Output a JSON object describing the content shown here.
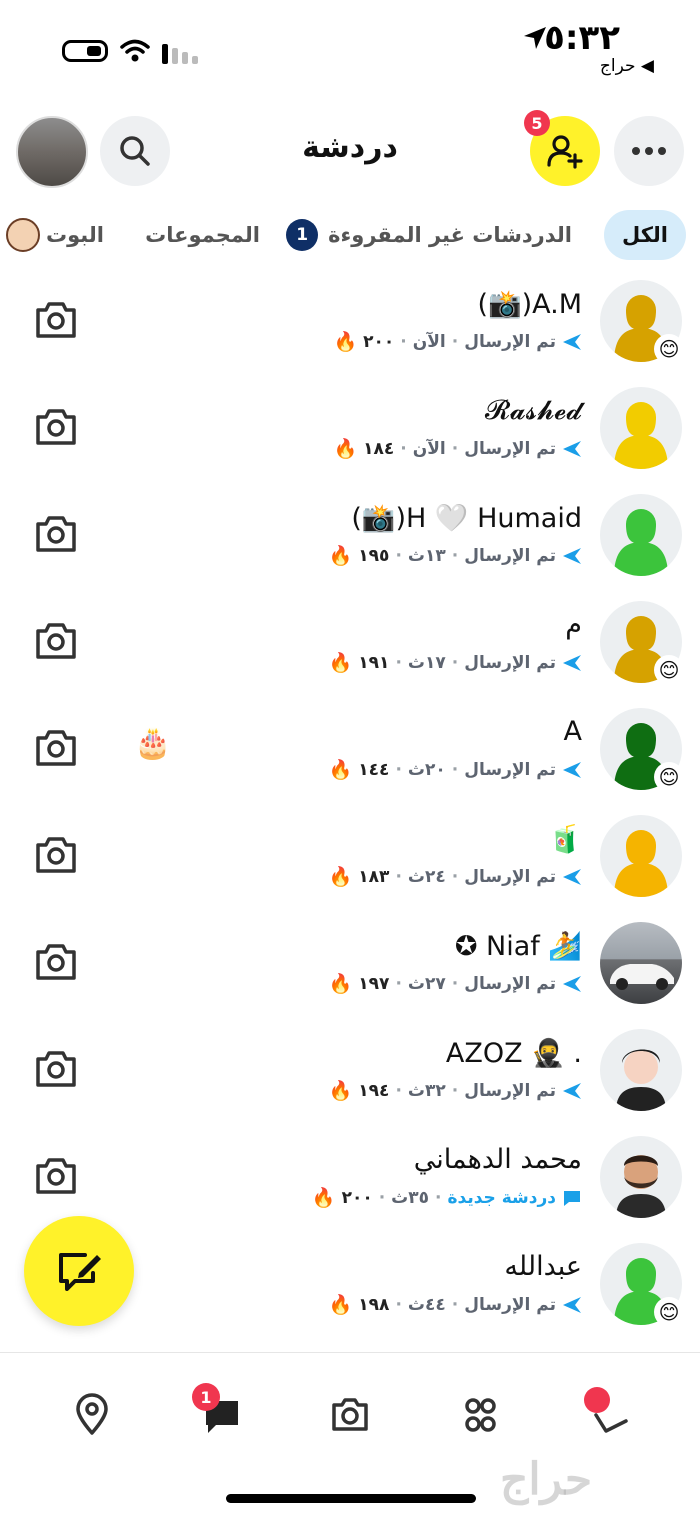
{
  "status_bar": {
    "time": "٥:٣٢",
    "back_app": "◀ حراج"
  },
  "header": {
    "title": "دردشة",
    "friend_requests_badge": "5"
  },
  "tabs": {
    "all": "الكل",
    "unread": "الدردشات غير المقروءة",
    "unread_count": "1",
    "groups": "المجموعات",
    "bots": "البوت"
  },
  "chats": [
    {
      "name": "A.M(📸)",
      "status": "تم الإرسال",
      "time": "الآن",
      "streak": "٢٠٠",
      "fire": "🔥",
      "avatar_color": "#d6a200",
      "emoji_badge": "😊"
    },
    {
      "name": "𝓡𝓪𝓼𝓱𝓮𝓭",
      "status": "تم الإرسال",
      "time": "الآن",
      "streak": "١٨٤",
      "fire": "🔥",
      "avatar_color": "#f2cc00",
      "emoji_badge": ""
    },
    {
      "name": "H 🤍 Humaid(📸)",
      "status": "تم الإرسال",
      "time": "١٣ث",
      "streak": "١٩٥",
      "fire": "🔥",
      "avatar_color": "#3cc43c",
      "emoji_badge": ""
    },
    {
      "name": "م",
      "status": "تم الإرسال",
      "time": "١٧ث",
      "streak": "١٩١",
      "fire": "🔥",
      "avatar_color": "#d6a200",
      "emoji_badge": "😊"
    },
    {
      "name": "A",
      "status": "تم الإرسال",
      "time": "٢٠ث",
      "streak": "١٤٤",
      "fire": "🔥",
      "avatar_color": "#0f6e12",
      "emoji_badge": "😊",
      "extra_emoji": "🎂"
    },
    {
      "name": "🧃",
      "status": "تم الإرسال",
      "time": "٢٤ث",
      "streak": "١٨٣",
      "fire": "🔥",
      "avatar_color": "#f5b400",
      "emoji_badge": ""
    },
    {
      "name": "🏄 Niaf ✪",
      "status": "تم الإرسال",
      "time": "٢٧ث",
      "streak": "١٩٧",
      "fire": "🔥",
      "avatar_color": "photo-car",
      "emoji_badge": ""
    },
    {
      "name": ". 🥷 AZOZ",
      "status": "تم الإرسال",
      "time": "٣٢ث",
      "streak": "١٩٤",
      "fire": "🔥",
      "avatar_color": "bitmoji-boy",
      "emoji_badge": ""
    },
    {
      "name": "محمد الدهماني",
      "status": "دردشة جديدة",
      "time": "٣٥ث",
      "streak": "٢٠٠",
      "fire": "🔥",
      "avatar_color": "bitmoji-man",
      "emoji_badge": "",
      "is_new": true
    },
    {
      "name": "عبدالله",
      "status": "تم الإرسال",
      "time": "٤٤ث",
      "streak": "١٩٨",
      "fire": "🔥",
      "avatar_color": "#3cc43c",
      "emoji_badge": "😊"
    }
  ],
  "bottom_nav": {
    "chat_badge": "1",
    "items": [
      "map-icon",
      "chat-icon",
      "camera-icon",
      "stories-icon",
      "spotlight-icon"
    ]
  },
  "watermark": "حراج",
  "colors": {
    "brand_yellow": "#fff22a",
    "badge_red": "#f0364f",
    "sent_blue": "#1a9ee8",
    "tab_active_bg": "#d6ecfa"
  }
}
